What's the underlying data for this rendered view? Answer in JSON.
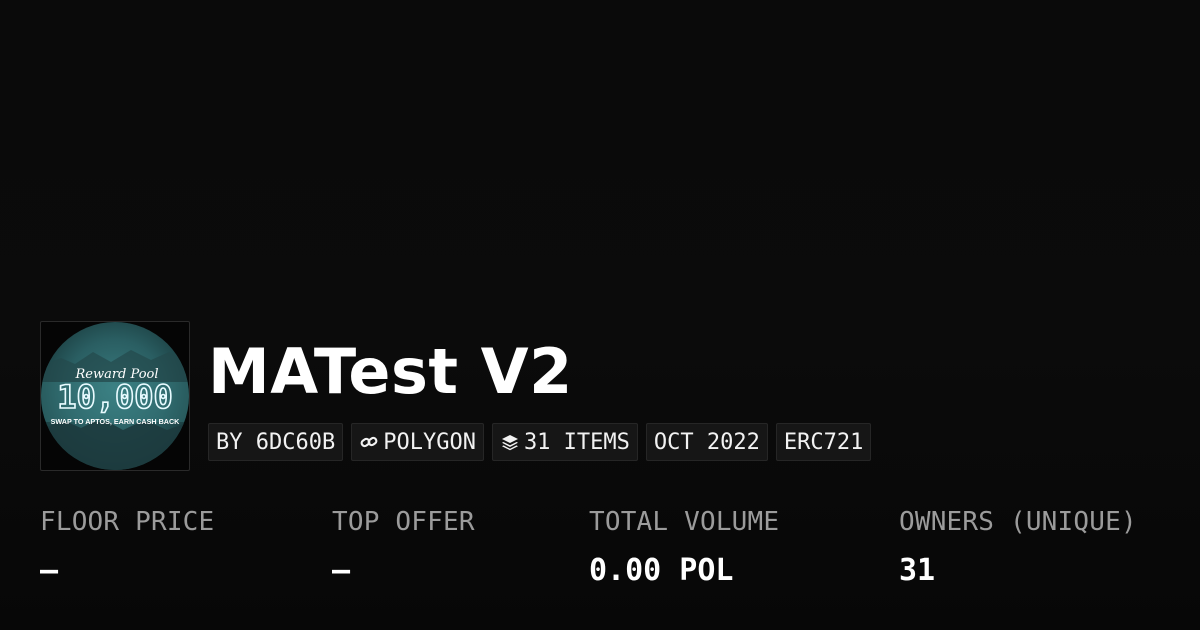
{
  "collection": {
    "name": "MATest V2",
    "avatar": {
      "icon": "collection-logo-image",
      "top_text": "Reward Pool",
      "main_text": "10,000",
      "bottom_text": "SWAP TO APTOS, EARN CASH BACK"
    },
    "badges": {
      "creator": "BY 6DC60B",
      "chain": "POLYGON",
      "chain_icon": "link-icon",
      "items": "31 ITEMS",
      "items_icon": "layers-icon",
      "date": "OCT 2022",
      "standard": "ERC721"
    }
  },
  "stats": [
    {
      "label": "FLOOR PRICE",
      "value": "–"
    },
    {
      "label": "TOP OFFER",
      "value": "–"
    },
    {
      "label": "TOTAL VOLUME",
      "value": "0.00 POL"
    },
    {
      "label": "OWNERS (UNIQUE)",
      "value": "31"
    }
  ],
  "colors": {
    "background": "#0b0b0b",
    "badge_background": "#161616",
    "label_gray": "#9b9b9b",
    "avatar_teal": "#2b5f63"
  }
}
